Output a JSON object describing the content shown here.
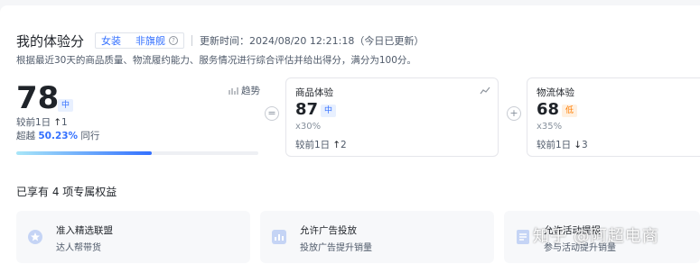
{
  "header": {
    "title": "我的体验分",
    "tag_category": "女装",
    "tag_type": "非旗舰",
    "update_time": "更新时间：2024/08/20 12:21:18（今日已更新）"
  },
  "description": "根据最近30天的商品质量、物流履约能力、服务情况进行综合评估并给出得分，满分为100分。",
  "overall": {
    "score": "78",
    "grade": "中",
    "trend_label": "趋势",
    "compare_label": "较前1日",
    "compare_arrow": "↑",
    "compare_value": "1",
    "beat_prefix": "超越",
    "beat_pct": "50.23%",
    "beat_suffix": "同行",
    "progress": 0.56
  },
  "operators": {
    "equals": "=",
    "plus": "+"
  },
  "sub_scores": [
    {
      "label": "商品体验",
      "score": "87",
      "grade": "中",
      "weight": "x30%",
      "compare_label": "较前1日",
      "compare_arrow": "↑",
      "compare_value": "2"
    },
    {
      "label": "物流体验",
      "score": "68",
      "grade": "低",
      "weight": "x35%",
      "compare_label": "较前1日",
      "compare_arrow": "↓",
      "compare_value": "3"
    }
  ],
  "benefits_section": {
    "title": "已享有 4 项专属权益",
    "items": [
      {
        "title": "准入精选联盟",
        "subtitle": "达人帮带货"
      },
      {
        "title": "允许广告投放",
        "subtitle": "投放广告提升销量"
      },
      {
        "title": "允许活动提报",
        "subtitle": "参与活动提升销量"
      }
    ]
  },
  "watermark": "知乎 @阿超电商",
  "colors": {
    "accent": "#3370ff",
    "grade_mid_bg": "#e8f0ff",
    "grade_low": "#ff7d00"
  }
}
